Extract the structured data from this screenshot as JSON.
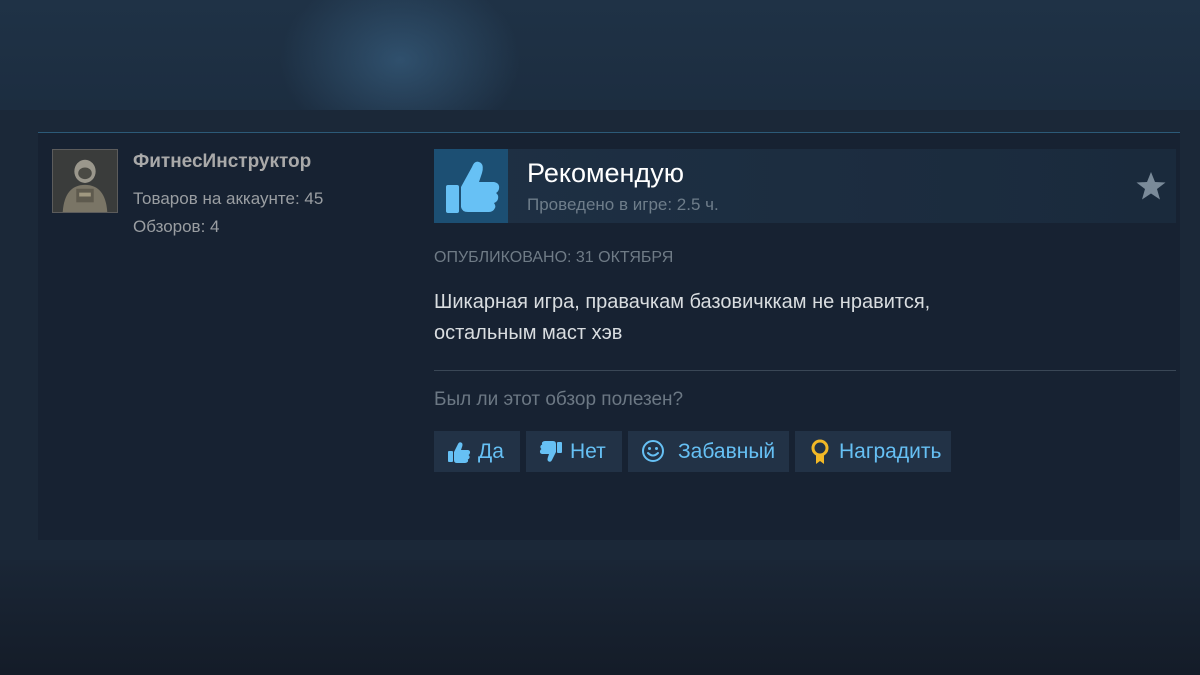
{
  "author": {
    "name": "ФитнесИнструктор",
    "products_on_account": "Товаров на аккаунте: 45",
    "reviews_count": "Обзоров: 4"
  },
  "review": {
    "verdict": "Рекомендую",
    "hours": "Проведено в игре: 2.5 ч.",
    "posted": "ОПУБЛИКОВАНО: 31 ОКТЯБРЯ",
    "text_line1": "Шикарная игра, правачкам базовичккам не нравится,",
    "text_line2": "остальным маст хэв"
  },
  "helpful": {
    "question": "Был ли этот обзор полезен?",
    "buttons": {
      "yes": "Да",
      "no": "Нет",
      "funny": "Забавный",
      "award": "Наградить"
    }
  },
  "icons": {
    "verdict": "thumbs-up-icon",
    "favorite": "star-icon",
    "yes": "thumbs-up-icon",
    "no": "thumbs-down-icon",
    "funny": "smiley-icon",
    "award": "award-medal-icon"
  },
  "colors": {
    "accent_link": "#66c0f4",
    "card_bg": "#172232",
    "thumb_bg": "#1c4f73",
    "award_gold": "#f2b826"
  }
}
